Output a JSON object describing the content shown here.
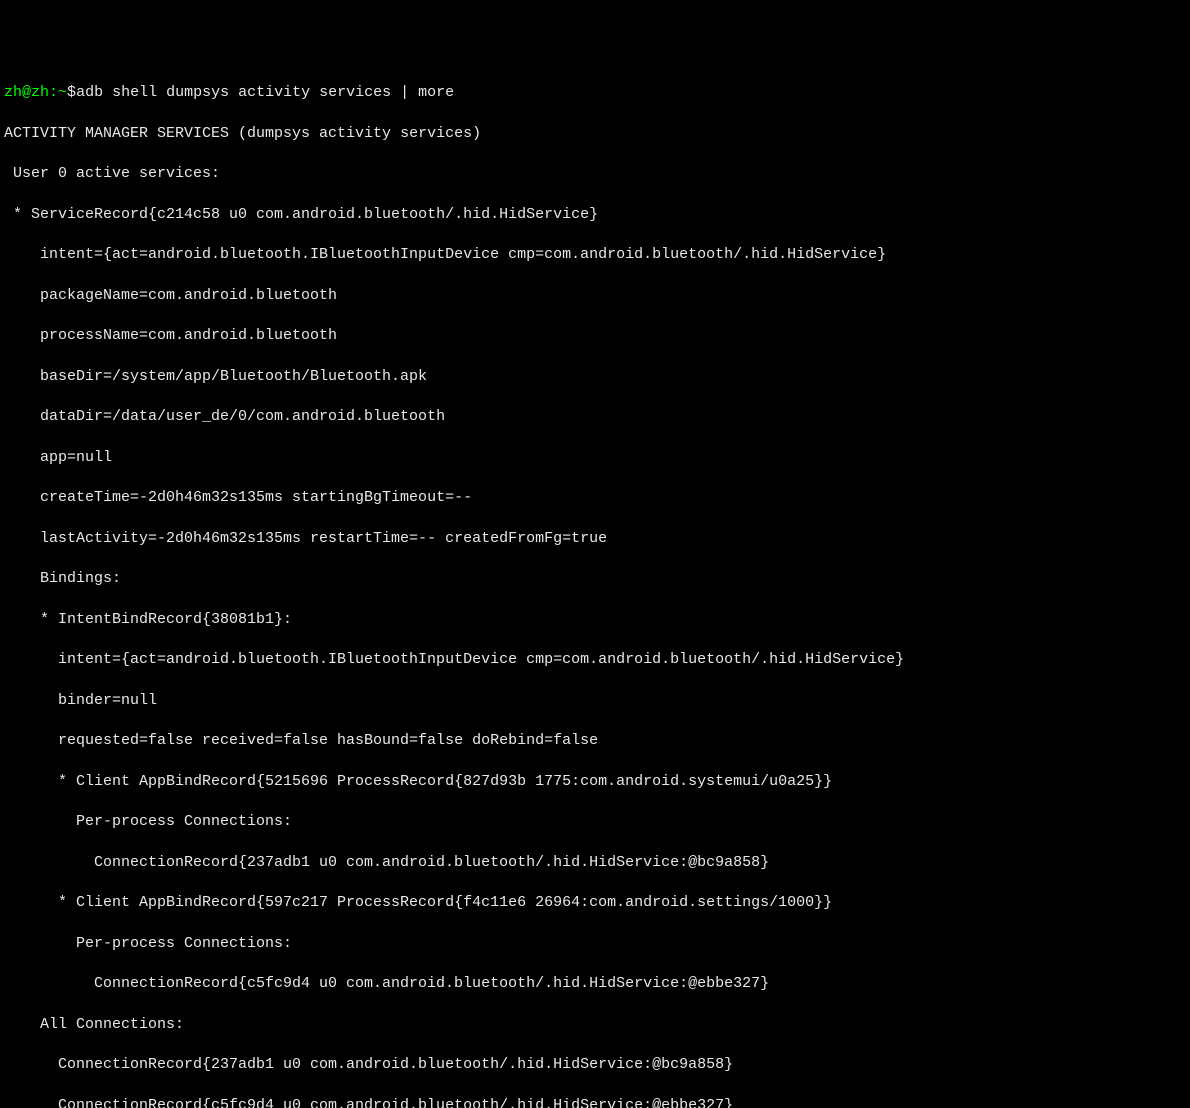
{
  "prompt": {
    "user": "zh@zh",
    "path": "~",
    "dollar": "$",
    "command": "adb shell dumpsys activity services | more"
  },
  "output": {
    "header": "ACTIVITY MANAGER SERVICES (dumpsys activity services)",
    "user_line": "User 0 active services:",
    "service_record": "* ServiceRecord{c214c58 u0 com.android.bluetooth/.hid.HidService}",
    "intent": "intent={act=android.bluetooth.IBluetoothInputDevice cmp=com.android.bluetooth/.hid.HidService}",
    "package_name": "packageName=com.android.bluetooth",
    "process_name": "processName=com.android.bluetooth",
    "base_dir": "baseDir=/system/app/Bluetooth/Bluetooth.apk",
    "data_dir": "dataDir=/data/user_de/0/com.android.bluetooth",
    "app": "app=null",
    "create_time": "createTime=-2d0h46m32s135ms startingBgTimeout=--",
    "last_activity": "lastActivity=-2d0h46m32s135ms restartTime=-- createdFromFg=true",
    "bindings": "Bindings:",
    "intent_bind_record": "* IntentBindRecord{38081b1}:",
    "bind_intent": "intent={act=android.bluetooth.IBluetoothInputDevice cmp=com.android.bluetooth/.hid.HidService}",
    "binder": "binder=null",
    "requested": "requested=false received=false hasBound=false doRebind=false",
    "client1": "* Client AppBindRecord{5215696 ProcessRecord{827d93b 1775:com.android.systemui/u0a25}}",
    "client1_perproc": "Per-process Connections:",
    "client1_conn": "ConnectionRecord{237adb1 u0 com.android.bluetooth/.hid.HidService:@bc9a858}",
    "client2": "* Client AppBindRecord{597c217 ProcessRecord{f4c11e6 26964:com.android.settings/1000}}",
    "client2_perproc": "Per-process Connections:",
    "client2_conn": "ConnectionRecord{c5fc9d4 u0 com.android.bluetooth/.hid.HidService:@ebbe327}",
    "all_conns": "All Connections:",
    "all_conn1": "ConnectionRecord{237adb1 u0 com.android.bluetooth/.hid.HidService:@bc9a858}",
    "all_conn2": "ConnectionRecord{c5fc9d4 u0 com.android.bluetooth/.hid.HidService:@ebbe327}"
  }
}
